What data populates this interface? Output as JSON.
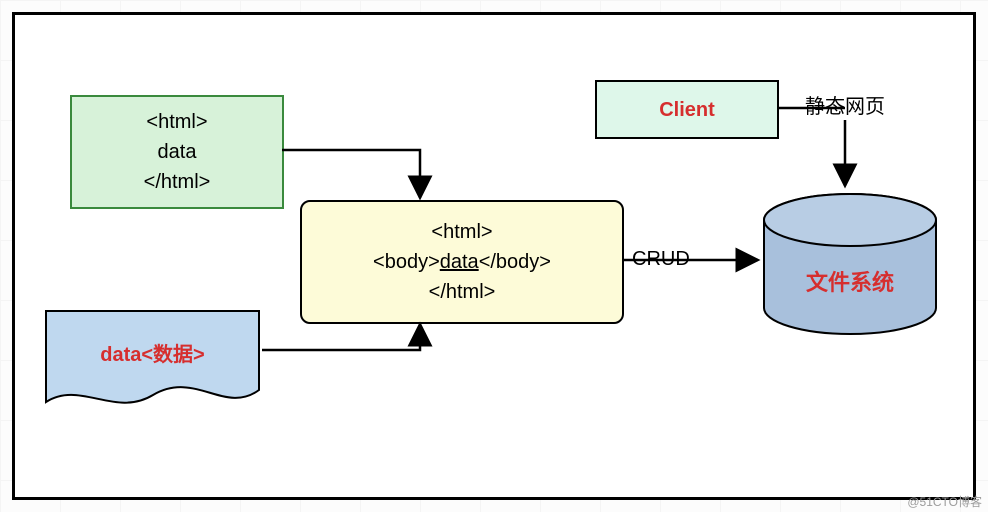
{
  "template_box": {
    "line1": "<html>",
    "line2": "data",
    "line3": "</html>"
  },
  "data_doc": {
    "label": "data<数据>"
  },
  "merged_box": {
    "line1": "<html>",
    "line2_pre": "<body>",
    "line2_data": "data",
    "line2_post": "</body>",
    "line3": "</html>"
  },
  "client_box": {
    "label": "Client"
  },
  "static_label": "静态网页",
  "crud_label": "CRUD",
  "cylinder_label": "文件系统",
  "watermark": "@51CTO博客"
}
